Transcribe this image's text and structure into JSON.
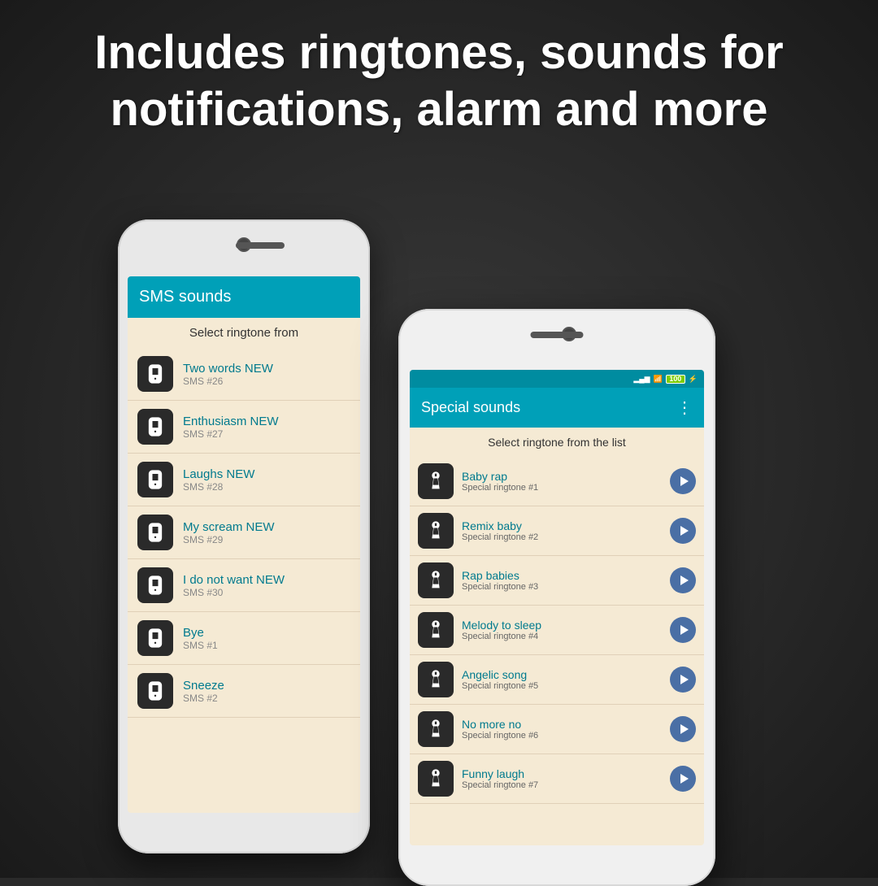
{
  "header": {
    "line1": "Includes ringtones, sounds for",
    "line2": "notifications, alarm and more"
  },
  "phone1": {
    "app_bar_title": "SMS sounds",
    "list_header": "Select ringtone from",
    "items": [
      {
        "title": "Two words NEW",
        "subtitle": "SMS #26"
      },
      {
        "title": "Enthusiasm NEW",
        "subtitle": "SMS #27"
      },
      {
        "title": "Laughs NEW",
        "subtitle": "SMS #28"
      },
      {
        "title": "My scream NEW",
        "subtitle": "SMS #29"
      },
      {
        "title": "I do not want NEW",
        "subtitle": "SMS #30"
      },
      {
        "title": "Bye",
        "subtitle": "SMS #1"
      },
      {
        "title": "Sneeze",
        "subtitle": "SMS #2"
      }
    ]
  },
  "phone2": {
    "status": {
      "signal": "▂▄▆",
      "wifi": "WiFi",
      "battery": "100",
      "charge": "⚡"
    },
    "app_bar_title": "Special sounds",
    "list_header": "Select ringtone from the list",
    "items": [
      {
        "title": "Baby rap",
        "subtitle": "Special ringtone #1"
      },
      {
        "title": "Remix baby",
        "subtitle": "Special ringtone #2"
      },
      {
        "title": "Rap babies",
        "subtitle": "Special ringtone #3"
      },
      {
        "title": "Melody to sleep",
        "subtitle": "Special ringtone #4"
      },
      {
        "title": "Angelic song",
        "subtitle": "Special ringtone #5"
      },
      {
        "title": "No more no",
        "subtitle": "Special ringtone #6"
      },
      {
        "title": "Funny laugh",
        "subtitle": "Special ringtone #7"
      }
    ]
  }
}
